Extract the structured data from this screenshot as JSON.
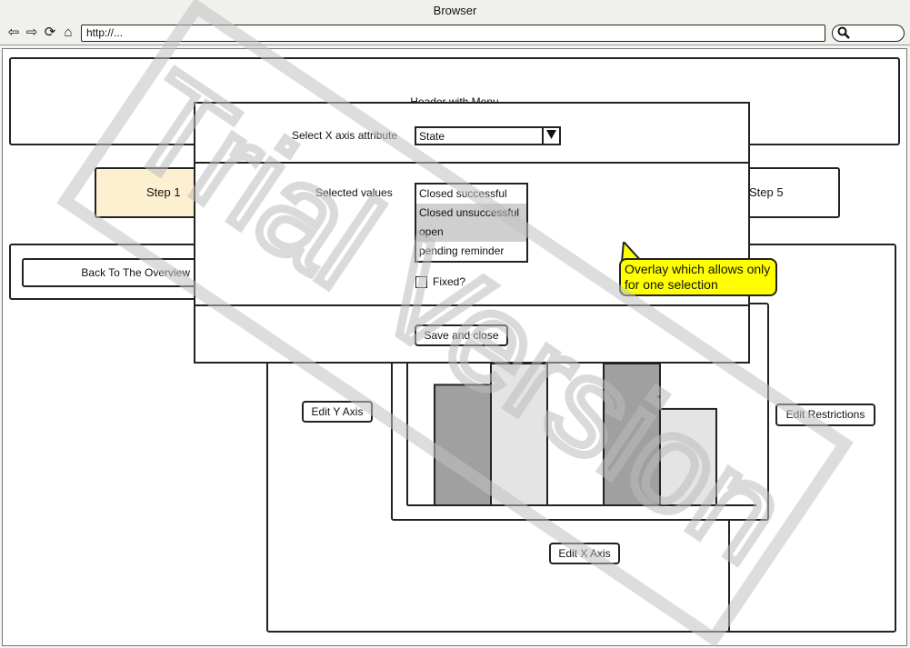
{
  "browser": {
    "title": "Browser",
    "url": "http://..."
  },
  "page": {
    "header_text": "Header with Menu",
    "steps": {
      "step1": "Step 1",
      "step5": "Step 5"
    },
    "back_button": "Back To The Overview",
    "edit_y_axis": "Edit Y Axis",
    "edit_x_axis": "Edit X Axis",
    "edit_restrictions": "Edit Restrictions"
  },
  "overlay": {
    "x_axis_label": "Select X axis attribute",
    "x_axis_value": "State",
    "selected_values_label": "Selected values",
    "options": [
      "Closed successful",
      "Closed unsuccessful",
      "open",
      "pending reminder"
    ],
    "selected_options": [
      false,
      true,
      true,
      false
    ],
    "fixed_label": "Fixed?",
    "fixed_checked": false,
    "save_button": "Save and close"
  },
  "callout": {
    "text_line1": "Overlay which allows only",
    "text_line2": "for one selection",
    "color": "#ffff00"
  },
  "watermark": {
    "text": "Trial Version"
  },
  "chart_data": {
    "type": "bar",
    "categories": [
      "",
      "",
      "",
      "",
      "",
      ""
    ],
    "values": [
      0.85,
      1.0,
      0,
      1.0,
      0.68,
      0
    ],
    "colors": [
      "#a0a0a0",
      "#e4e4e4",
      "#ffffff",
      "#a0a0a0",
      "#e4e4e4",
      "#ffffff"
    ],
    "ylim": [
      0,
      1
    ],
    "title": "",
    "xlabel": "",
    "ylabel": ""
  }
}
